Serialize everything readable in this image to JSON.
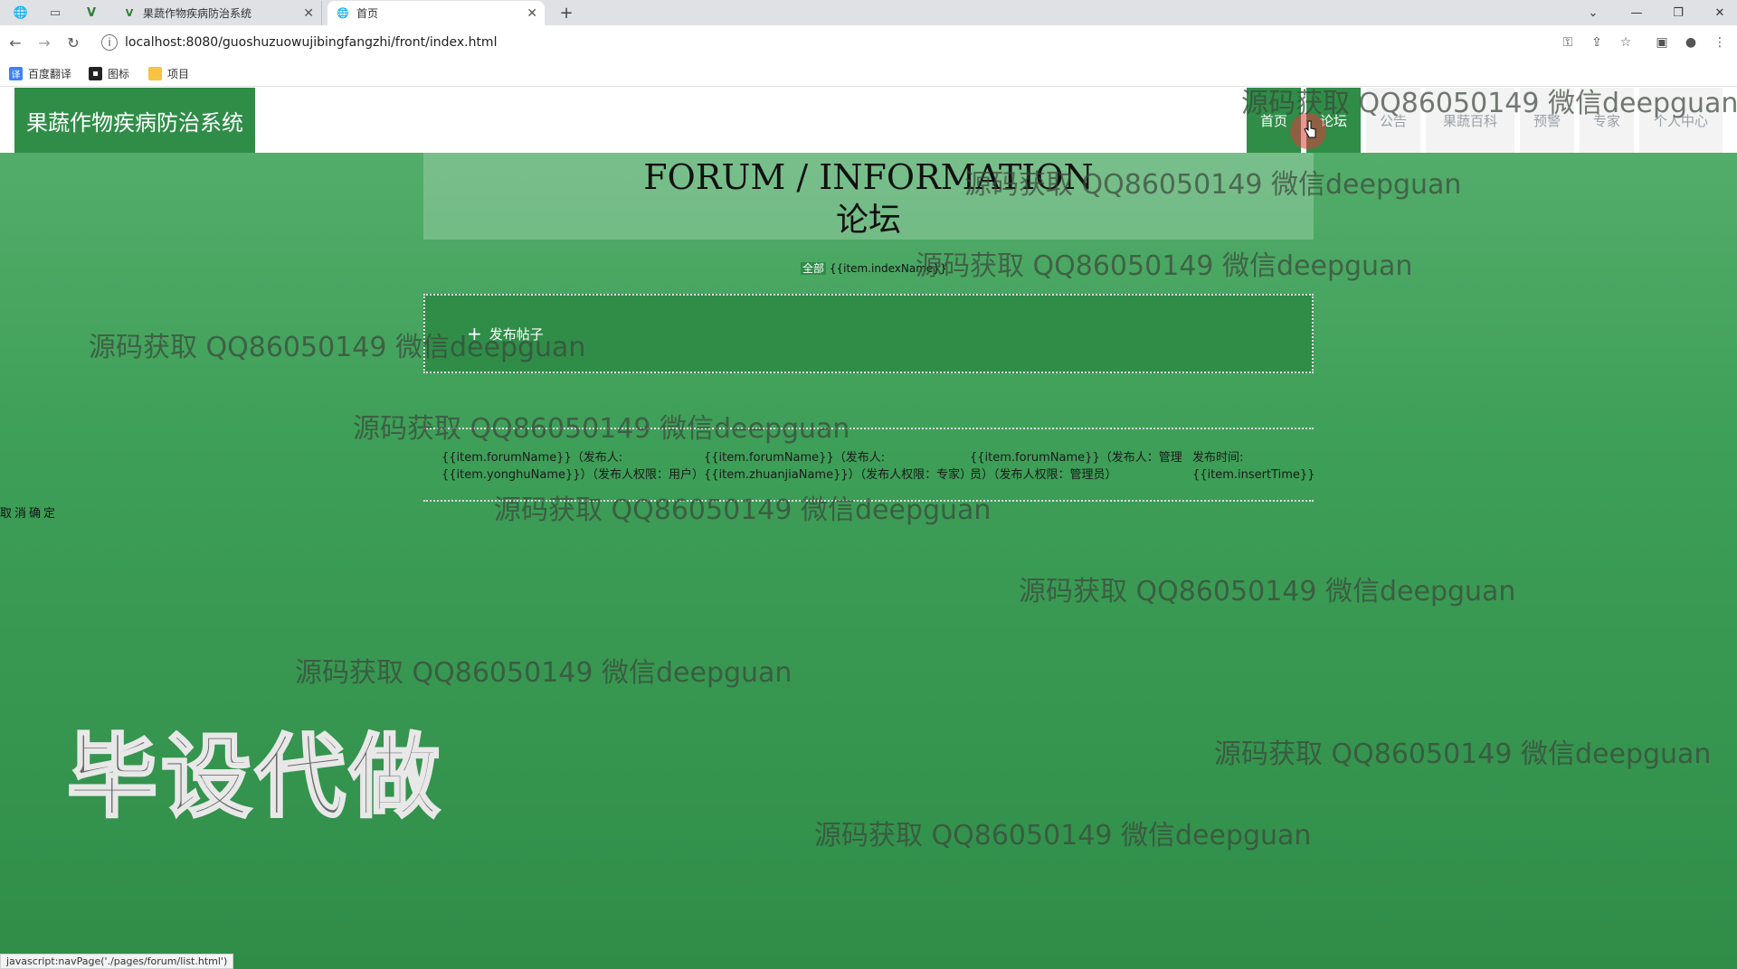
{
  "browser": {
    "tabs": [
      {
        "title": "果蔬作物疾病防治系统"
      },
      {
        "title": "首页"
      }
    ],
    "url": "localhost:8080/guoshuzuowujibingfangzhi/front/index.html",
    "bookmarks": [
      "百度翻译",
      "图标",
      "项目"
    ],
    "status_url": "javascript:navPage('./pages/forum/list.html')"
  },
  "header": {
    "logo": "果蔬作物疾病防治系统",
    "nav": [
      "首页",
      "论坛",
      "公告",
      "果蔬百科",
      "预警",
      "专家",
      "个人中心"
    ]
  },
  "forum": {
    "title_en": "FORUM / INFORMATION",
    "title_cn": "论坛",
    "category_all": "全部",
    "category_item": "{{item.indexName}}",
    "publish_label": "发布帖子",
    "post": {
      "col1": [
        "{{item.forumName}}（发布人:",
        "{{item.yonghuName}}）（发布人权限：用户）"
      ],
      "col2": [
        "{{item.forumName}}（发布人:",
        "{{item.zhuanjiaName}}）（发布人权限：专家）"
      ],
      "col3": [
        "{{item.forumName}}（发布人：管理",
        "员）（发布人权限：管理员）"
      ],
      "col4": [
        "发布时间:",
        "{{item.insertTime}}"
      ]
    }
  },
  "left_actions": "取消确定",
  "watermark_text": "源码获取 QQ86050149 微信deepguan",
  "big_ad": "毕设代做"
}
